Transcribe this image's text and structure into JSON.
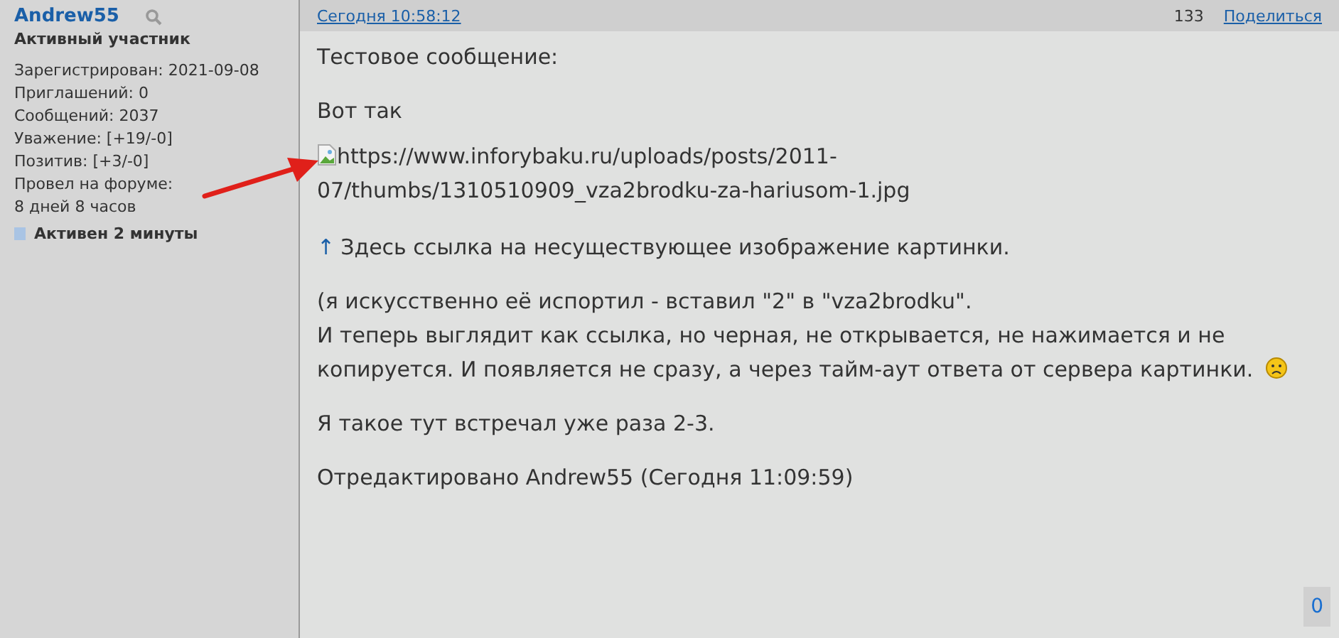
{
  "author": {
    "name": "Andrew55",
    "rank": "Активный участник",
    "stats": [
      "Зарегистрирован: 2021-09-08",
      "Приглашений: 0",
      "Сообщений: 2037",
      "Уважение: [+19/-0]",
      "Позитив: [+3/-0]",
      "Провел на форуме:",
      "8 дней 8 часов"
    ],
    "activity": "Активен 2 минуты"
  },
  "post": {
    "date": "Сегодня 10:58:12",
    "views": "133",
    "share": "Поделиться",
    "blocks": [
      {
        "kind": "text",
        "lines": [
          "Тестовое сообщение:"
        ]
      },
      {
        "kind": "text",
        "lines": [
          "Вот так"
        ]
      },
      {
        "kind": "broken_image",
        "alt": "https://www.inforybaku.ru/uploads/posts/2011-07/thumbs/1310510909_vza2brodku-za-hariusom-1.jpg"
      },
      {
        "kind": "note",
        "arrow": "↑",
        "lines": [
          "Здесь ссылка на несуществующее изображение картинки."
        ]
      },
      {
        "kind": "text_emoji",
        "lines": [
          "(я искусственно её испортил - вставил \"2\" в \"vza2brodku\".",
          "И теперь выглядит как ссылка, но черная, не открывается, не нажимается и не копируется. И появляется не сразу, а через тайм-аут ответа от сервера картинки."
        ]
      },
      {
        "kind": "text",
        "lines": [
          "Я такое тут встречал уже раза 2-3."
        ]
      },
      {
        "kind": "text",
        "lines": [
          "Отредактировано Andrew55 (Сегодня 11:09:59)"
        ]
      }
    ],
    "counter": "0"
  }
}
